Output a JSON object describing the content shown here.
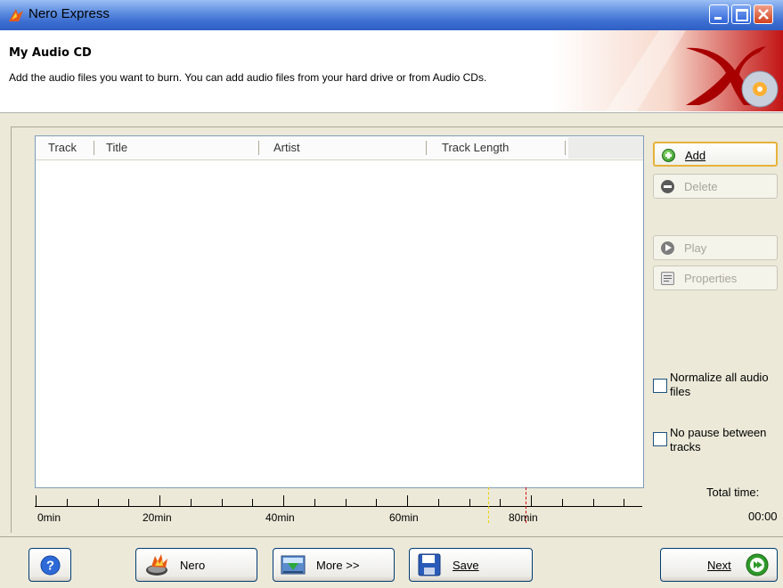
{
  "window": {
    "title": "Nero Express"
  },
  "header": {
    "title": "My Audio CD",
    "description": "Add the audio files you want to burn. You can add audio files from your hard drive or from Audio CDs."
  },
  "list": {
    "columns": [
      "Track",
      "Title",
      "Artist",
      "Track Length"
    ],
    "rows": []
  },
  "ruler": {
    "labels": [
      "0min",
      "20min",
      "40min",
      "60min",
      "80min"
    ]
  },
  "side_buttons": {
    "add": "Add",
    "delete": "Delete",
    "play": "Play",
    "properties": "Properties"
  },
  "options": {
    "normalize": {
      "label": "Normalize all audio files",
      "checked": false
    },
    "no_pause": {
      "label": "No pause between tracks",
      "checked": false
    }
  },
  "total": {
    "label": "Total time:",
    "value": "00:00"
  },
  "bottom": {
    "nero": "Nero",
    "more": "More >>",
    "save": "Save",
    "next": "Next"
  },
  "colors": {
    "title_bar": "#3d6fd2",
    "accent_add": "#e6b23a",
    "ruler_yellow": "#e8d200",
    "ruler_red": "#d40000"
  }
}
